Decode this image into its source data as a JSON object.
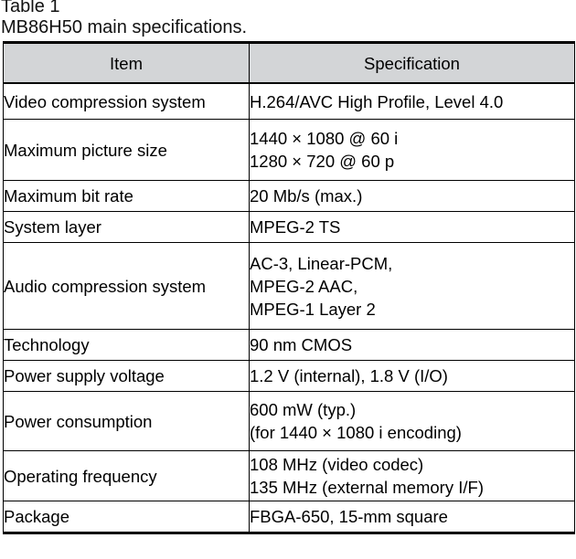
{
  "caption": {
    "label": "Table 1",
    "title": "MB86H50 main specifications."
  },
  "table": {
    "columns": [
      {
        "key": "item",
        "header": "Item"
      },
      {
        "key": "specification",
        "header": "Specification"
      }
    ],
    "header_background": "#d3d5d7",
    "rows": [
      {
        "item": "Video compression system",
        "specification": "H.264/AVC High Profile, Level 4.0"
      },
      {
        "item": "Maximum picture size",
        "specification": "1440 × 1080 @ 60 i\n1280 × 720 @ 60 p"
      },
      {
        "item": "Maximum bit rate",
        "specification": "20 Mb/s (max.)"
      },
      {
        "item": "System layer",
        "specification": "MPEG-2 TS"
      },
      {
        "item": "Audio compression system",
        "specification": "AC-3, Linear-PCM,\nMPEG-2 AAC,\nMPEG-1 Layer 2"
      },
      {
        "item": "Technology",
        "specification": "90 nm CMOS"
      },
      {
        "item": "Power supply voltage",
        "specification": "1.2 V (internal), 1.8 V (I/O)"
      },
      {
        "item": "Power consumption",
        "specification": "600 mW (typ.)\n(for 1440 × 1080 i encoding)"
      },
      {
        "item": "Operating frequency",
        "specification": "108 MHz (video codec)\n135 MHz (external memory I/F)"
      },
      {
        "item": "Package",
        "specification": "FBGA-650, 15-mm square"
      }
    ]
  }
}
